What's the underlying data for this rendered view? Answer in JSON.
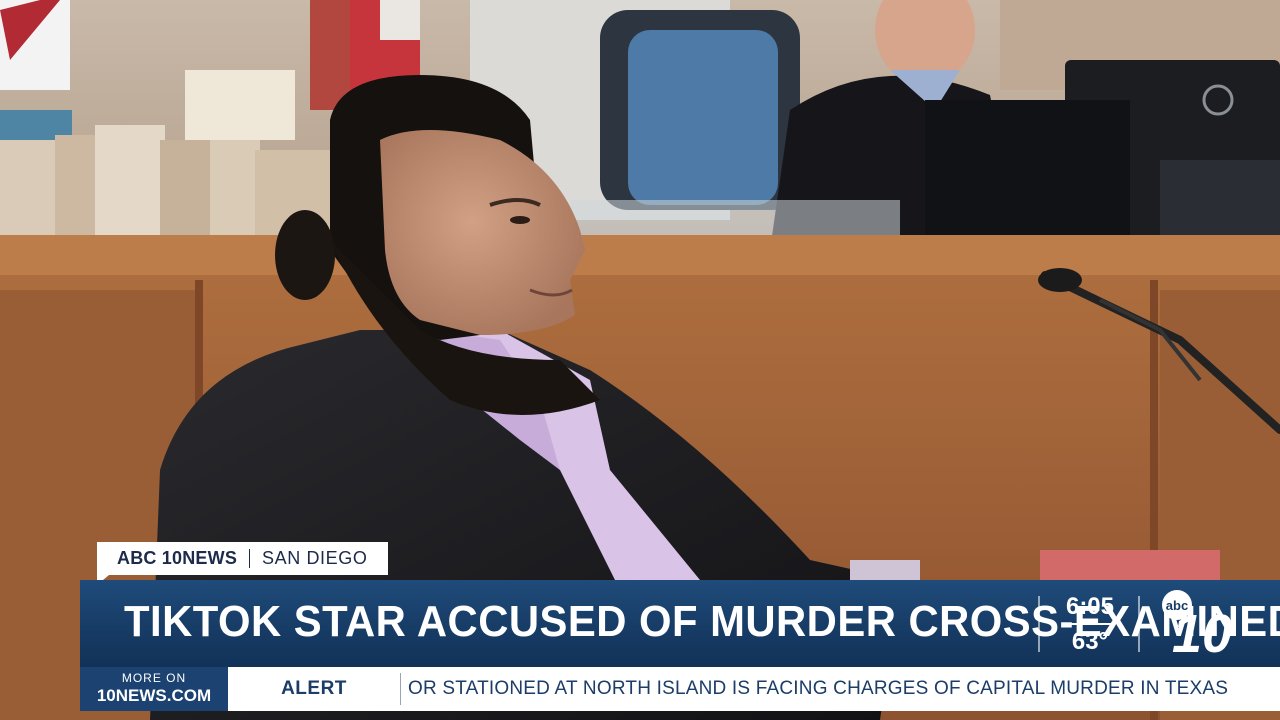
{
  "broadcast": {
    "brand": "ABC 10NEWS",
    "location": "SAN DIEGO",
    "headline": "TIKTOK STAR ACCUSED OF MURDER CROSS-EXAMINED",
    "time": "6:05",
    "temperature": "63°",
    "logo": {
      "small_text": "abc",
      "big_text": "10"
    }
  },
  "ticker": {
    "more_on_line1": "MORE ON",
    "more_on_line2": "10NEWS.COM",
    "label": "ALERT",
    "text": "OR STATIONED AT NORTH ISLAND IS FACING CHARGES OF CAPITAL MURDER IN TEXAS"
  },
  "colors": {
    "headline_bar": "#173c66",
    "ticker_accent": "#1b4270",
    "wood_panel": "#a4643a"
  }
}
